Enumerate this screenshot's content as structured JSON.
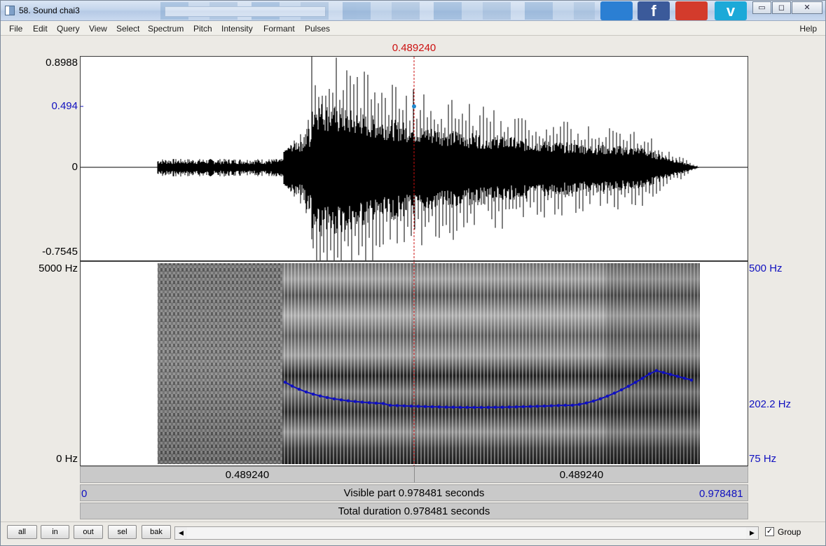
{
  "window": {
    "title": "58. Sound chai3",
    "minimize": "▭",
    "maximize": "◻",
    "close": "✕"
  },
  "social": {
    "facebook": "f",
    "vimeo": "v"
  },
  "menu": [
    "File",
    "Edit",
    "Query",
    "View",
    "Select",
    "Spectrum",
    "Pitch",
    "Intensity",
    "Formant",
    "Pulses"
  ],
  "menu_help": "Help",
  "cursor": {
    "time_label": "0.489240"
  },
  "waveform": {
    "max_label": "0.8988",
    "value_label": "0.494",
    "zero_label": "0",
    "min_label": "-0.7545"
  },
  "spectrogram": {
    "top_freq": "5000 Hz",
    "bottom_freq": "0 Hz"
  },
  "pitch_axis": {
    "top": "500 Hz",
    "value": "202.2 Hz",
    "bottom": "75 Hz"
  },
  "timebar": {
    "left": "0.489240",
    "right": "0.489240"
  },
  "visible": {
    "start": "0",
    "text": "Visible part 0.978481 seconds",
    "end": "0.978481"
  },
  "total": {
    "text": "Total duration 0.978481 seconds"
  },
  "buttons": {
    "all": "all",
    "in": "in",
    "out": "out",
    "sel": "sel",
    "bak": "bak"
  },
  "group": {
    "label": "Group",
    "checked": "✓"
  },
  "colors": {
    "cursor": "#cc1111",
    "pitch": "#1010c0",
    "accent_blue": "#1010c0"
  }
}
